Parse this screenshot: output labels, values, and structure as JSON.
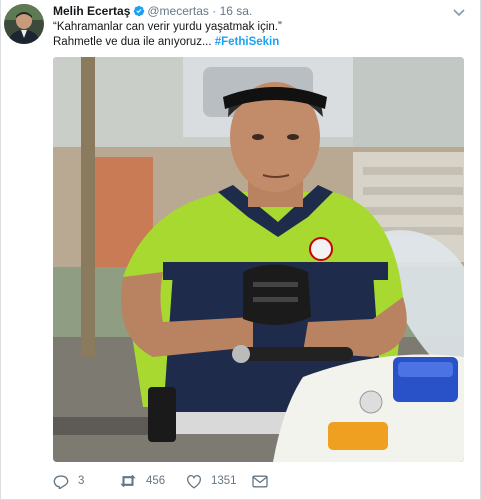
{
  "tweet": {
    "author_name": "Melih Ecertaş",
    "author_handle": "@mecertas",
    "separator": "·",
    "time": "16 sa.",
    "text_line1": "“Kahramanlar can verir yurdu yaşatmak için.”",
    "text_line2_prefix": "Rahmetle ve dua ile anıyoruz...",
    "hashtag": "#FethiSekin",
    "icons": {
      "verified": "verified-badge-icon",
      "menu": "chevron-down-icon",
      "reply": "reply-icon",
      "retweet": "retweet-icon",
      "like": "heart-icon",
      "dm": "envelope-icon"
    },
    "actions": {
      "reply_count": "3",
      "retweet_count": "456",
      "like_count": "1351"
    },
    "colors": {
      "link_blue": "#1da1f2",
      "muted_gray": "#657786",
      "text_dark": "#14171a"
    }
  }
}
